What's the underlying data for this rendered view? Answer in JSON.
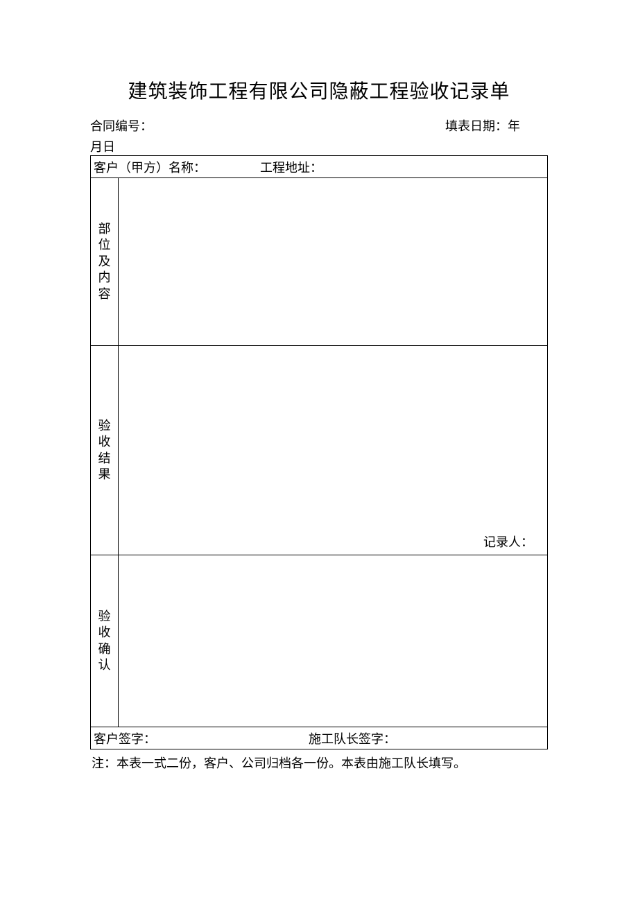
{
  "title": "建筑装饰工程有限公司隐蔽工程验收记录单",
  "header": {
    "contract_label": "合同编号：",
    "date_label": "填表日期：年",
    "date_label_line2": "月日"
  },
  "row1": {
    "customer_label": "客户（甲方）名称：",
    "address_label": "工程地址："
  },
  "sections": {
    "section1_label": "部位及内容",
    "section2_label": "验收结果",
    "section2_recorder": "记录人：",
    "section3_label": "验收确认"
  },
  "signature": {
    "customer_sig_label": "客户签字：",
    "foreman_sig_label": "施工队长签字："
  },
  "note": "注：本表一式二份，客户、公司归档各一份。本表由施工队长填写。"
}
